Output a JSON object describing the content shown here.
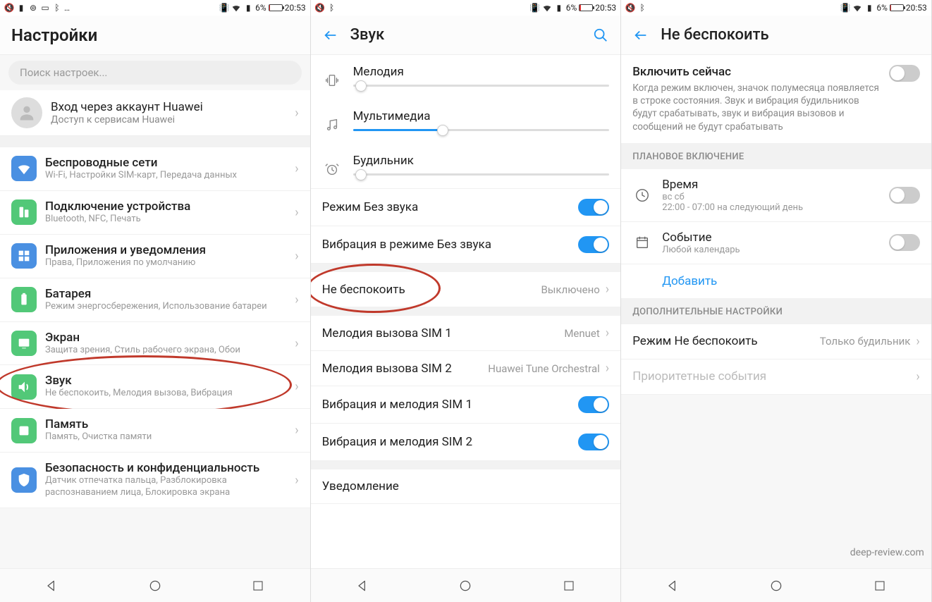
{
  "status": {
    "battery_percent": "6%",
    "time": "20:53"
  },
  "screen1": {
    "title": "Настройки",
    "search_placeholder": "Поиск настроек...",
    "account": {
      "title": "Вход через аккаунт Huawei",
      "sub": "Доступ к сервисам Huawei"
    },
    "items": [
      {
        "title": "Беспроводные сети",
        "sub": "Wi-Fi, Настройки SIM-карт, Передача данных"
      },
      {
        "title": "Подключение устройства",
        "sub": "Bluetooth, NFC, Печать"
      },
      {
        "title": "Приложения и уведомления",
        "sub": "Права, Приложения по умолчанию"
      },
      {
        "title": "Батарея",
        "sub": "Режим энергосбережения, Использование батареи"
      },
      {
        "title": "Экран",
        "sub": "Защита зрения, Стиль рабочего экрана, Обои"
      },
      {
        "title": "Звук",
        "sub": "Не беспокоить, Мелодия вызова, Вибрация"
      },
      {
        "title": "Память",
        "sub": "Память, Очистка памяти"
      },
      {
        "title": "Безопасность и конфиденциальность",
        "sub": "Датчик отпечатка пальца, Разблокировка распознаванием лица, Блокировка экрана"
      }
    ]
  },
  "screen2": {
    "title": "Звук",
    "sliders": {
      "ringtone": "Мелодия",
      "media": "Мультимедиа",
      "alarm": "Будильник"
    },
    "silent": {
      "label": "Режим Без звука",
      "on": true
    },
    "vibrate_silent": {
      "label": "Вибрация в режиме Без звука",
      "on": true
    },
    "dnd": {
      "label": "Не беспокоить",
      "value": "Выключено"
    },
    "sim1_ring": {
      "label": "Мелодия вызова SIM 1",
      "value": "Menuet"
    },
    "sim2_ring": {
      "label": "Мелодия вызова SIM 2",
      "value": "Huawei Tune Orchestral"
    },
    "vib_sim1": {
      "label": "Вибрация и мелодия SIM 1",
      "on": true
    },
    "vib_sim2": {
      "label": "Вибрация и мелодия SIM 2",
      "on": true
    },
    "notification": {
      "label": "Уведомление"
    }
  },
  "screen3": {
    "title": "Не беспокоить",
    "enable": {
      "title": "Включить сейчас",
      "desc": "Когда режим включен, значок полумесяца появляется в строке состояния. Звук и вибрация будильников будут срабатывать, звук и вибрация вызовов и сообщений не будут срабатывать",
      "on": false
    },
    "section_schedule": "ПЛАНОВОЕ ВКЛЮЧЕНИЕ",
    "time": {
      "title": "Время",
      "sub1": "вс сб",
      "sub2": "22:00 - 07:00 на следующий день",
      "on": false
    },
    "event": {
      "title": "Событие",
      "sub": "Любой календарь",
      "on": false
    },
    "add": "Добавить",
    "section_extra": "ДОПОЛНИТЕЛЬНЫЕ НАСТРОЙКИ",
    "dnd_mode": {
      "label": "Режим Не беспокоить",
      "value": "Только будильник"
    },
    "priority": {
      "label": "Приоритетные события"
    }
  },
  "watermark": "deep-review.com"
}
